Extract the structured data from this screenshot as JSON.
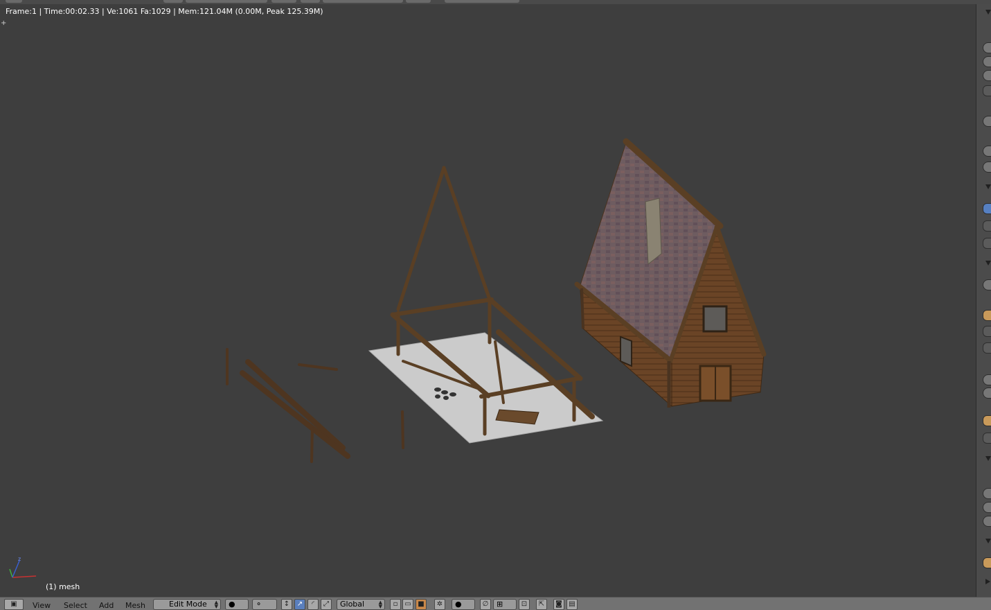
{
  "viewport": {
    "info_text": "Frame:1 | Time:00:02.33 | Ve:1061 Fa:1029 | Mem:121.04M (0.00M, Peak 125.39M)",
    "object_label": "(1) mesh",
    "axes": {
      "x": "x",
      "y": "y",
      "z": "z"
    }
  },
  "header_menu": {
    "view": "View",
    "select": "Select",
    "add": "Add",
    "mesh": "Mesh",
    "mode": "Edit Mode",
    "orientation": "Global"
  },
  "colors": {
    "viewport_bg": "#3e3e3e",
    "wood": "#5a3f26",
    "roof": "#6d5a5e",
    "ground": "#c9c9c9",
    "selected": "#5a7fbd"
  },
  "icons": [
    "editor-type-icon",
    "shading-sphere-icon",
    "pivot-icon",
    "manipulator-icon",
    "translate-icon",
    "rotate-icon",
    "scale-icon",
    "vertex-select-icon",
    "edge-select-icon",
    "face-select-icon",
    "occlude-icon",
    "proportional-icon",
    "snap-icon",
    "render-icon",
    "camera-icon"
  ]
}
